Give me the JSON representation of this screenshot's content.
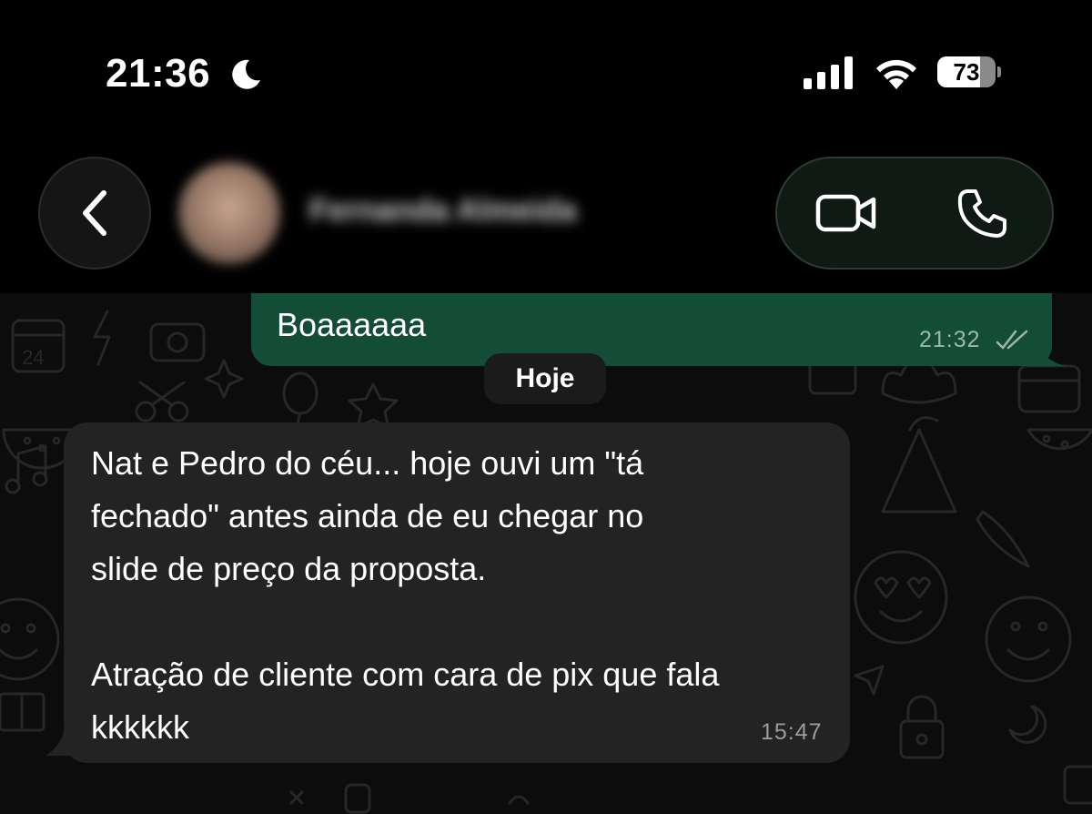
{
  "status_bar": {
    "time": "21:36",
    "battery_level": "73",
    "battery_fraction": 0.73,
    "icons": [
      "moon-icon",
      "signal-icon",
      "wifi-icon",
      "battery-icon"
    ]
  },
  "header": {
    "back_icon": "chevron-left-icon",
    "contact_name": "Fernanda Almeida",
    "contact_name_blurred": true,
    "actions": [
      "video-camera-icon",
      "phone-icon"
    ]
  },
  "chat": {
    "outgoing_message": {
      "text": "Boaaaaaa",
      "time": "21:32",
      "status_icon": "double-check-icon"
    },
    "date_separator": "Hoje",
    "incoming_message": {
      "text": "Nat e Pedro do céu... hoje ouvi um \"tá\nfechado\" antes ainda de eu chegar no\nslide de preço da proposta.\n\nAtração de cliente com cara de pix que fala\nkkkkkk",
      "time": "15:47"
    }
  },
  "colors": {
    "background": "#000000",
    "outgoing_bubble": "#144d37",
    "incoming_bubble": "#222322",
    "date_chip": "#1a1b1a",
    "call_pill": "#0f1a14"
  }
}
